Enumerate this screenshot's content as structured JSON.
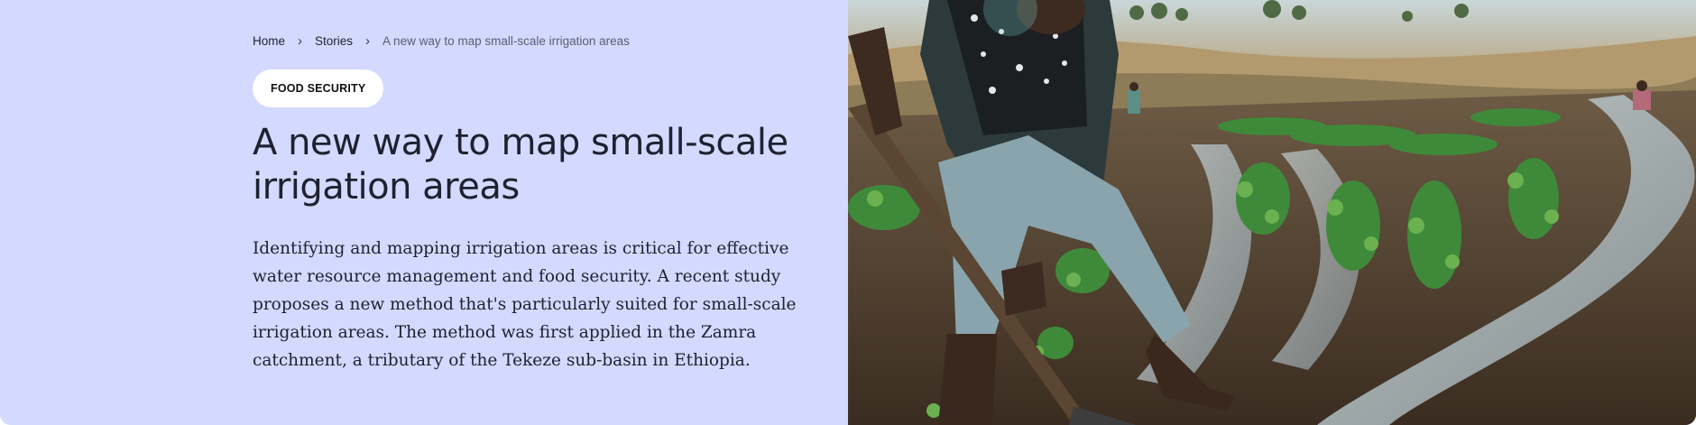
{
  "breadcrumb": {
    "home": "Home",
    "stories": "Stories",
    "current": "A new way to map small-scale irrigation areas",
    "separator": "›"
  },
  "tag": "FOOD SECURITY",
  "title": "A new way to map small-scale irrigation areas",
  "description": "Identifying and mapping irrigation areas is critical for effective water resource management and food security. A recent study proposes a new method that's particularly suited for small-scale irrigation areas. The method was first applied in the Zamra catchment, a tributary of the Tekeze sub-basin in Ethiopia.",
  "colors": {
    "background": "#d4d9ff",
    "text": "#1e2130",
    "tag_bg": "#ffffff"
  },
  "photo": {
    "subject": "farmer-irrigating-field"
  }
}
